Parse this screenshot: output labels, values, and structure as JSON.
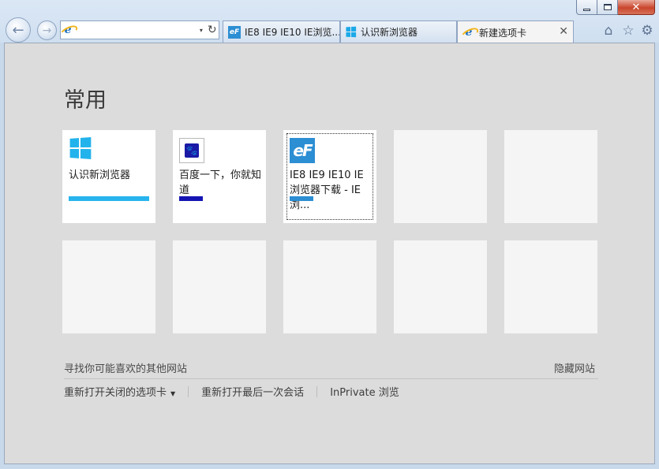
{
  "window": {
    "close_label": "✕",
    "min_icon": "minimize-icon",
    "max_icon": "maximize-icon"
  },
  "nav": {
    "back_glyph": "←",
    "forward_glyph": "→",
    "refresh_glyph": "↻",
    "dropdown_glyph": "▾"
  },
  "address": {
    "value": "",
    "placeholder": ""
  },
  "tabs": [
    {
      "label": "IE8 IE9 IE10 IE浏览...",
      "favicon": "ef-favicon",
      "active": false
    },
    {
      "label": "认识新浏览器",
      "favicon": "windows-favicon",
      "active": false
    },
    {
      "label": "新建选项卡",
      "favicon": "ie-favicon",
      "active": true,
      "close": "✕"
    }
  ],
  "toolbar": {
    "home_glyph": "⌂",
    "favorites_glyph": "☆",
    "tools_glyph": "⚙"
  },
  "content": {
    "title": "常用",
    "tiles": [
      {
        "label": "认识新浏览器",
        "icon": "windows-logo-icon",
        "bar_color": "#27b4ee"
      },
      {
        "label": "百度一下，你就知道",
        "icon": "baidu-paw-icon",
        "bar_color": "#1414b4"
      },
      {
        "label": "IE8 IE9 IE10 IE浏览器下载 - IE浏...",
        "icon": "ef-logo-icon",
        "bar_color": "#2c8ed3"
      }
    ],
    "baidu_glyph": "🐾",
    "ef_glyph": "eF",
    "suggest_link": "寻找你可能喜欢的其他网站",
    "hide_link": "隐藏网站",
    "bottom_links": {
      "reopen_closed": "重新打开关闭的选项卡",
      "reopen_caret": "▼",
      "reopen_session": "重新打开最后一次会话",
      "inprivate": "InPrivate 浏览"
    }
  }
}
